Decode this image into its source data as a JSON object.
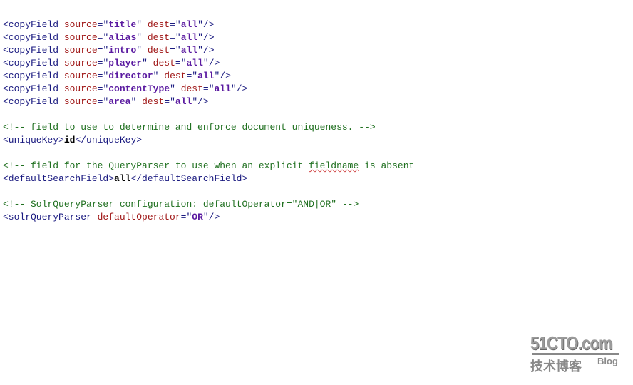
{
  "editor": {
    "lines": [
      [
        [
          "tag",
          "<copyField "
        ],
        [
          "attr",
          "source"
        ],
        [
          "punct",
          "=\""
        ],
        [
          "val",
          "title"
        ],
        [
          "punct",
          "\" "
        ],
        [
          "attr",
          "dest"
        ],
        [
          "punct",
          "=\""
        ],
        [
          "val",
          "all"
        ],
        [
          "punct",
          "\"/>"
        ]
      ],
      [
        [
          "tag",
          "<copyField "
        ],
        [
          "attr",
          "source"
        ],
        [
          "punct",
          "=\""
        ],
        [
          "val",
          "alias"
        ],
        [
          "punct",
          "\" "
        ],
        [
          "attr",
          "dest"
        ],
        [
          "punct",
          "=\""
        ],
        [
          "val",
          "all"
        ],
        [
          "punct",
          "\"/>"
        ]
      ],
      [
        [
          "tag",
          "<copyField "
        ],
        [
          "attr",
          "source"
        ],
        [
          "punct",
          "=\""
        ],
        [
          "val",
          "intro"
        ],
        [
          "punct",
          "\" "
        ],
        [
          "attr",
          "dest"
        ],
        [
          "punct",
          "=\""
        ],
        [
          "val",
          "all"
        ],
        [
          "punct",
          "\"/>"
        ]
      ],
      [
        [
          "tag",
          "<copyField "
        ],
        [
          "attr",
          "source"
        ],
        [
          "punct",
          "=\""
        ],
        [
          "val",
          "player"
        ],
        [
          "punct",
          "\" "
        ],
        [
          "attr",
          "dest"
        ],
        [
          "punct",
          "=\""
        ],
        [
          "val",
          "all"
        ],
        [
          "punct",
          "\"/>"
        ]
      ],
      [
        [
          "tag",
          "<copyField "
        ],
        [
          "attr",
          "source"
        ],
        [
          "punct",
          "=\""
        ],
        [
          "val",
          "director"
        ],
        [
          "punct",
          "\" "
        ],
        [
          "attr",
          "dest"
        ],
        [
          "punct",
          "=\""
        ],
        [
          "val",
          "all"
        ],
        [
          "punct",
          "\"/>"
        ]
      ],
      [
        [
          "tag",
          "<copyField "
        ],
        [
          "attr",
          "source"
        ],
        [
          "punct",
          "=\""
        ],
        [
          "val",
          "contentType"
        ],
        [
          "punct",
          "\" "
        ],
        [
          "attr",
          "dest"
        ],
        [
          "punct",
          "=\""
        ],
        [
          "val",
          "all"
        ],
        [
          "punct",
          "\"/>"
        ]
      ],
      [
        [
          "tag",
          "<copyField "
        ],
        [
          "attr",
          "source"
        ],
        [
          "punct",
          "=\""
        ],
        [
          "val",
          "area"
        ],
        [
          "punct",
          "\" "
        ],
        [
          "attr",
          "dest"
        ],
        [
          "punct",
          "=\""
        ],
        [
          "val",
          "all"
        ],
        [
          "punct",
          "\"/>"
        ]
      ],
      [],
      [
        [
          "comment",
          "<!-- field to use to determine and enforce document uniqueness. -->"
        ]
      ],
      [
        [
          "tag",
          "<uniqueKey>"
        ],
        [
          "text",
          "id"
        ],
        [
          "tag",
          "</uniqueKey>"
        ]
      ],
      [],
      [
        [
          "comment",
          "<!-- field for the QueryParser to use when an explicit "
        ],
        [
          "spell",
          "fieldname"
        ],
        [
          "comment",
          " is absent"
        ]
      ],
      [
        [
          "tag",
          "<defaultSearchField>"
        ],
        [
          "text",
          "all"
        ],
        [
          "tag",
          "</defaultSearchField>"
        ]
      ],
      [],
      [
        [
          "comment",
          "<!-- SolrQueryParser configuration: defaultOperator=\"AND|OR\" -->"
        ]
      ],
      [
        [
          "tag",
          "<solrQueryParser "
        ],
        [
          "attr",
          "defaultOperator"
        ],
        [
          "punct",
          "=\""
        ],
        [
          "val",
          "OR"
        ],
        [
          "punct",
          "\"/>"
        ]
      ]
    ]
  },
  "watermark": {
    "brand": "51CTO.com",
    "subtitle": "技术博客",
    "blog": "Blog"
  }
}
